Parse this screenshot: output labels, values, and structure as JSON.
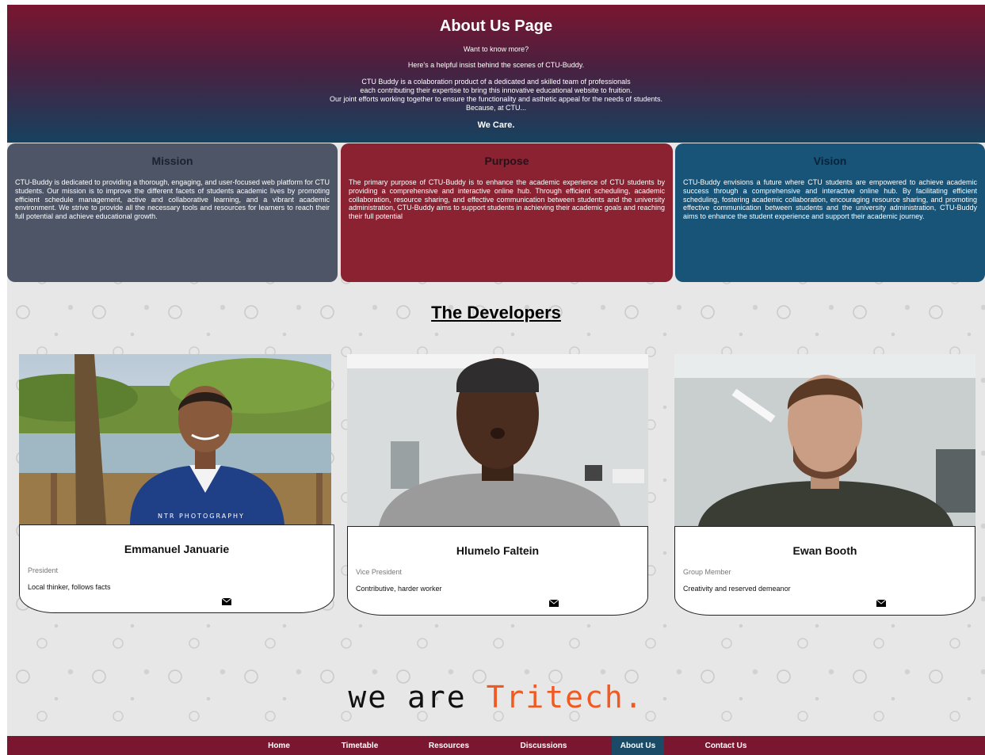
{
  "header": {
    "title": "About Us Page",
    "subtitle": "Want to know more?",
    "intro": "Here's a helpful insist behind the scenes of CTU-Buddy.",
    "body_lines": [
      "CTU Buddy is a colaboration product of a dedicated and skilled team of professionals",
      "each contributing their expertise to bring this innovative educational website to fruition.",
      "Our joint efforts working together to ensure the functionality and asthetic appeal for the needs of students.",
      "Because, at CTU..."
    ],
    "closing": "We Care."
  },
  "cards": {
    "mission": {
      "title": "Mission",
      "text": "CTU-Buddy is dedicated to providing a thorough, engaging, and user-focused web platform for CTU students. Our mission is to improve the different facets of students academic lives by promoting efficient schedule management, active and collaborative learning, and a vibrant academic environment. We strive to provide all the necessary tools and resources for learners to reach their full potential and achieve educational growth."
    },
    "purpose": {
      "title": "Purpose",
      "text": "The primary purpose of CTU-Buddy is to enhance the academic experience of CTU students by providing a comprehensive and interactive online hub. Through efficient scheduling, academic collaboration, resource sharing, and effective communication between students and the university administration, CTU-Buddy aims to support students in achieving their academic goals and reaching their full potential"
    },
    "vision": {
      "title": "Vision",
      "text": "CTU-Buddy envisions a future where CTU students are empowered to achieve academic success through a comprehensive and interactive online hub. By facilitating efficient scheduling, fostering academic collaboration, encouraging resource sharing, and promoting effective communication between students and the university administration, CTU-Buddy aims to enhance the student experience and support their academic journey."
    }
  },
  "developers_title": "The Developers",
  "developers": [
    {
      "name": "Emmanuel Januarie",
      "role": "President",
      "description": "Local thinker, follows facts",
      "photo_watermark": "NTR PHOTOGRAPHY",
      "contact_icon": "envelope-icon"
    },
    {
      "name": "Hlumelo Faltein",
      "role": "Vice President",
      "description": "Contributive, harder worker",
      "contact_icon": "envelope-icon"
    },
    {
      "name": "Ewan Booth",
      "role": "Group Member",
      "description": "Creativity and reserved demeanor",
      "contact_icon": "envelope-icon"
    }
  ],
  "tagline": {
    "plain": "we are ",
    "brand": "Tritech."
  },
  "nav": {
    "items": [
      {
        "label": "Home"
      },
      {
        "label": "Timetable"
      },
      {
        "label": "Resources"
      },
      {
        "label": "Discussions"
      },
      {
        "label": "About Us",
        "active": true
      },
      {
        "label": "Contact Us"
      }
    ]
  },
  "colors": {
    "nav_background": "#7a1630",
    "nav_active": "#1a4a66",
    "brand_accent": "#f05a22",
    "mission_card": "#4d5566",
    "purpose_card": "#8a2232",
    "vision_card": "#175477"
  }
}
